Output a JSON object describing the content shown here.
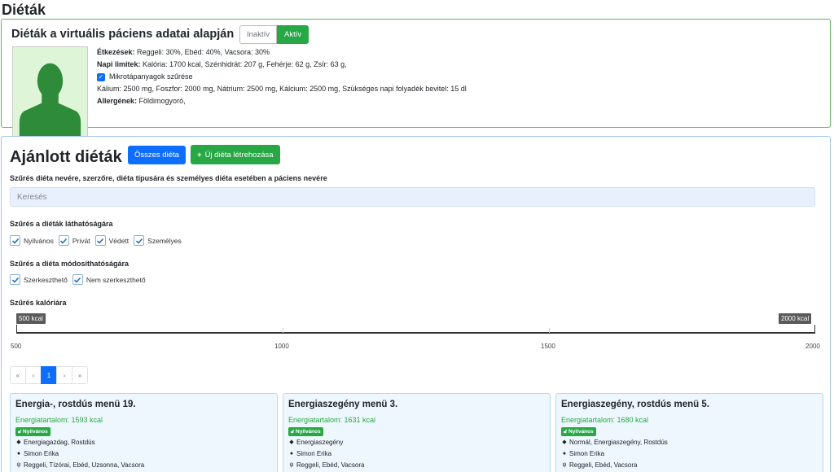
{
  "page": {
    "title": "Diéták"
  },
  "patient": {
    "title": "Diéták a virtuális páciens adatai alapján",
    "toggle": {
      "inactive_label": "Inaktív",
      "active_label": "Aktív"
    },
    "meals_label": "Étkezések:",
    "meals_value": "Reggeli: 30%, Ebéd: 40%, Vacsora: 30%",
    "limits_label": "Napi limitek:",
    "limits_value": "Kalória: 1700 kcal, Szénhidrát: 207 g, Fehérje: 62 g, Zsír: 63 g,",
    "micro_label": "Mikrotápanyagok szűrése",
    "micro_value": "Kálium: 2500 mg, Foszfor: 2000 mg, Nátrium: 2500 mg, Kálcium: 2500 mg, Szükséges napi folyadék bevitel: 15 dl",
    "allergens_label": "Allergének:",
    "allergens_value": "Földimogyoró,"
  },
  "diets": {
    "title": "Ajánlott diéták",
    "all_button": "Összes diéta",
    "new_button": "Új diéta létrehozása",
    "search_label": "Szűrés diéta nevére, szerzőre, diéta típusára és személyes diéta esetében a páciens nevére",
    "search_placeholder": "Keresés",
    "visibility_label": "Szűrés a diéták láthatóságára",
    "visibility_options": [
      "Nyilvános",
      "Privát",
      "Védett",
      "Személyes"
    ],
    "editability_label": "Szűrés a diéta módosíthatóságára",
    "editability_options": [
      "Szerkeszthető",
      "Nem szerkeszthető"
    ],
    "calorie_label": "Szűrés kalóriára",
    "slider": {
      "min_value": 500,
      "max_value": 2000,
      "low_tooltip": "500 kcal",
      "high_tooltip": "2000 kcal",
      "ticks": [
        "500",
        "1000",
        "1500",
        "2000"
      ]
    },
    "pagination": {
      "first": "«",
      "prev": "‹",
      "current": "1",
      "next": "›",
      "last": "»"
    },
    "cards": [
      {
        "title": "Energia-, rostdús menü 19.",
        "energy": "Energiatartalom: 1593 kcal",
        "badge": "Nyilvános",
        "tags": "Energiagazdag, Rostdús",
        "author": "Simon Erika",
        "meals": "Reggeli, Tízórai, Ebéd, Uzsonna, Vacsora"
      },
      {
        "title": "Energiaszegény menü 3.",
        "energy": "Energiatartalom: 1631 kcal",
        "badge": "Nyilvános",
        "tags": "Energiaszegény",
        "author": "Simon Erika",
        "meals": "Reggeli, Ebéd, Vacsora"
      },
      {
        "title": "Energiaszegény, rostdús menü 5.",
        "energy": "Energiatartalom: 1680 kcal",
        "badge": "Nyilvános",
        "tags": "Normál, Energiaszegény, Rostdús",
        "author": "Simon Erika",
        "meals": "Reggeli, Ebéd, Vacsora"
      }
    ]
  },
  "colors": {
    "primary": "#0d6efd",
    "success": "#28a745",
    "panel_border_green": "#5cb85c",
    "panel_border_blue": "#9ec5e6"
  }
}
